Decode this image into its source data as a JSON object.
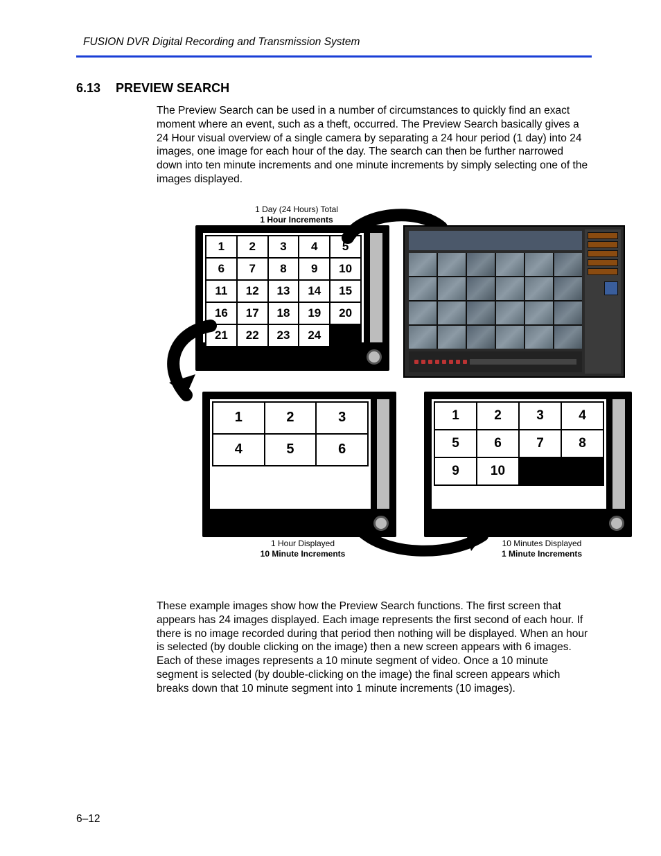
{
  "header": "FUSION DVR Digital Recording and Transmission System",
  "section_number": "6.13",
  "section_title": "PREVIEW SEARCH",
  "para1": "The Preview Search can be used in a number of circumstances to quickly find an exact moment where an event, such as a theft, occurred. The Preview Search basically gives a 24 Hour visual overview of a single camera by separating a 24 hour period (1 day) into 24 images, one image for each hour of the day. The search can then be further narrowed down into ten minute increments and one minute increments by simply selecting one of the images displayed.",
  "para2": "These example images show how the Preview Search functions. The first screen that appears has 24 images displayed. Each image represents the first second of each hour. If there is no image recorded during that period then nothing will be displayed. When an hour is selected (by double clicking on the image) then a new screen appears with 6 images. Each of these images represents a 10 minute segment of video. Once a 10 minute segment is selected (by double-clicking on the image) the final screen appears which breaks down that 10 minute segment into 1 minute increments (10 images).",
  "labels": {
    "top_line1": "1 Day (24 Hours) Total",
    "top_line2": "1 Hour Increments",
    "left_line1": "1 Hour Displayed",
    "left_line2": "10 Minute Increments",
    "right_line1": "10 Minutes Displayed",
    "right_line2": "1 Minute Increments"
  },
  "grids": {
    "hours": [
      "1",
      "2",
      "3",
      "4",
      "5",
      "6",
      "7",
      "8",
      "9",
      "10",
      "11",
      "12",
      "13",
      "14",
      "15",
      "16",
      "17",
      "18",
      "19",
      "20",
      "21",
      "22",
      "23",
      "24"
    ],
    "tenmin": [
      "1",
      "2",
      "3",
      "4",
      "5",
      "6"
    ],
    "onemin": [
      "1",
      "2",
      "3",
      "4",
      "5",
      "6",
      "7",
      "8",
      "9",
      "10"
    ]
  },
  "page_number": "6–12"
}
